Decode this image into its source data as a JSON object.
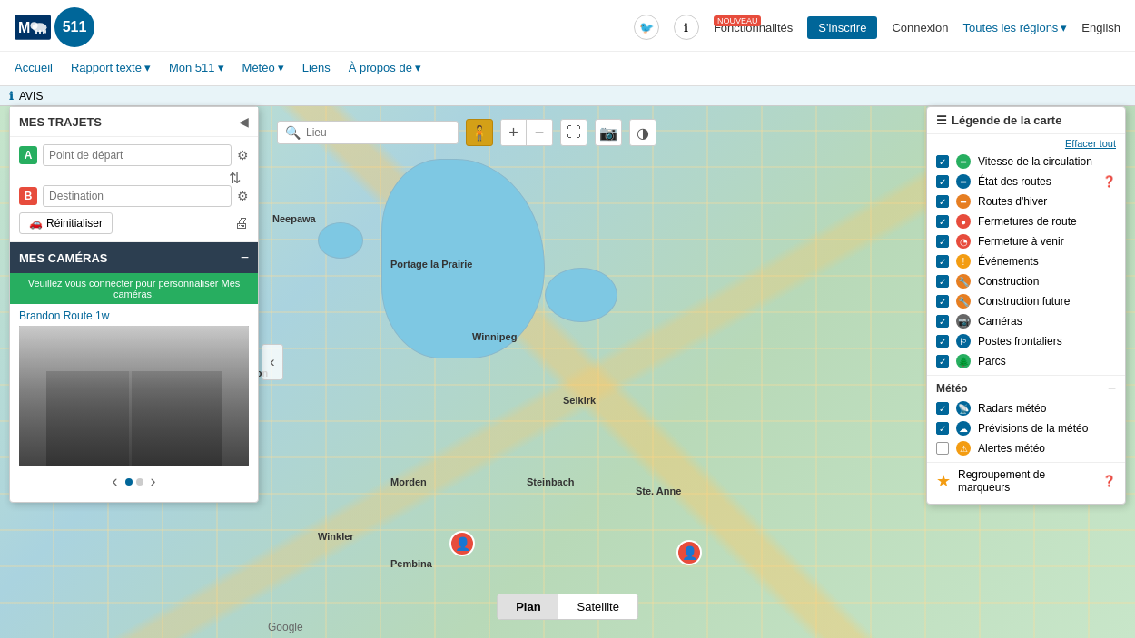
{
  "header": {
    "logo_alt": "Manitoba 511",
    "logo_511": "511",
    "nouveau_badge": "NOUVEAU",
    "fonctionnalites": "Fonctionnalités",
    "sinscrire": "S'inscrire",
    "connexion": "Connexion",
    "toutes_regions": "Toutes les régions",
    "english": "English",
    "twitter_icon": "🐦",
    "info_icon": "ℹ"
  },
  "nav": {
    "accueil": "Accueil",
    "rapport_texte": "Rapport texte",
    "mon_511": "Mon 511",
    "meteo": "Météo",
    "liens": "Liens",
    "a_propos": "À propos de"
  },
  "info_bar": {
    "icon": "ℹ",
    "text": "AVIS"
  },
  "left_panel": {
    "trajets_title": "MES TRAJETS",
    "point_a_label": "A",
    "point_b_label": "B",
    "point_a_placeholder": "Point de départ",
    "point_b_placeholder": "Destination",
    "reinitialiser": "Réinitialiser",
    "cameras_title": "MES CAMÉRAS",
    "login_prompt": "Veuillez vous connecter pour personnaliser Mes caméras.",
    "camera_name": "Brandon Route 1w",
    "camera_dot1": "active",
    "camera_dot2": ""
  },
  "map_controls": {
    "search_placeholder": "Lieu",
    "search_icon": "🔍",
    "zoom_in": "+",
    "zoom_out": "−"
  },
  "legend": {
    "title": "Légende de la carte",
    "effacer": "Effacer tout",
    "items": [
      {
        "label": "Vitesse de la circulation",
        "checked": true,
        "icon_color": "green"
      },
      {
        "label": "État des routes",
        "checked": true,
        "icon_color": "blue",
        "has_info": true
      },
      {
        "label": "Routes d'hiver",
        "checked": true,
        "icon_color": "orange"
      },
      {
        "label": "Fermetures de route",
        "checked": true,
        "icon_color": "red"
      },
      {
        "label": "Fermeture à venir",
        "checked": true,
        "icon_color": "red"
      },
      {
        "label": "Événements",
        "checked": true,
        "icon_color": "yellow"
      },
      {
        "label": "Construction",
        "checked": true,
        "icon_color": "orange"
      },
      {
        "label": "Construction future",
        "checked": true,
        "icon_color": "orange"
      },
      {
        "label": "Caméras",
        "checked": true,
        "icon_color": "gray"
      },
      {
        "label": "Postes frontaliers",
        "checked": true,
        "icon_color": "blue"
      },
      {
        "label": "Parcs",
        "checked": true,
        "icon_color": "green"
      }
    ],
    "meteo_title": "Météo",
    "meteo_items": [
      {
        "label": "Radars météo",
        "checked": true,
        "icon_color": "blue"
      },
      {
        "label": "Prévisions de la météo",
        "checked": true,
        "icon_color": "blue"
      },
      {
        "label": "Alertes météo",
        "checked": false,
        "icon_color": "yellow"
      }
    ],
    "groupement": "Regroupement de marqueurs",
    "groupement_checked": true
  },
  "map": {
    "plan_label": "Plan",
    "satellite_label": "Satellite",
    "active_view": "Plan",
    "google_logo": "Google",
    "winnipeg_label": "Winnipeg"
  }
}
